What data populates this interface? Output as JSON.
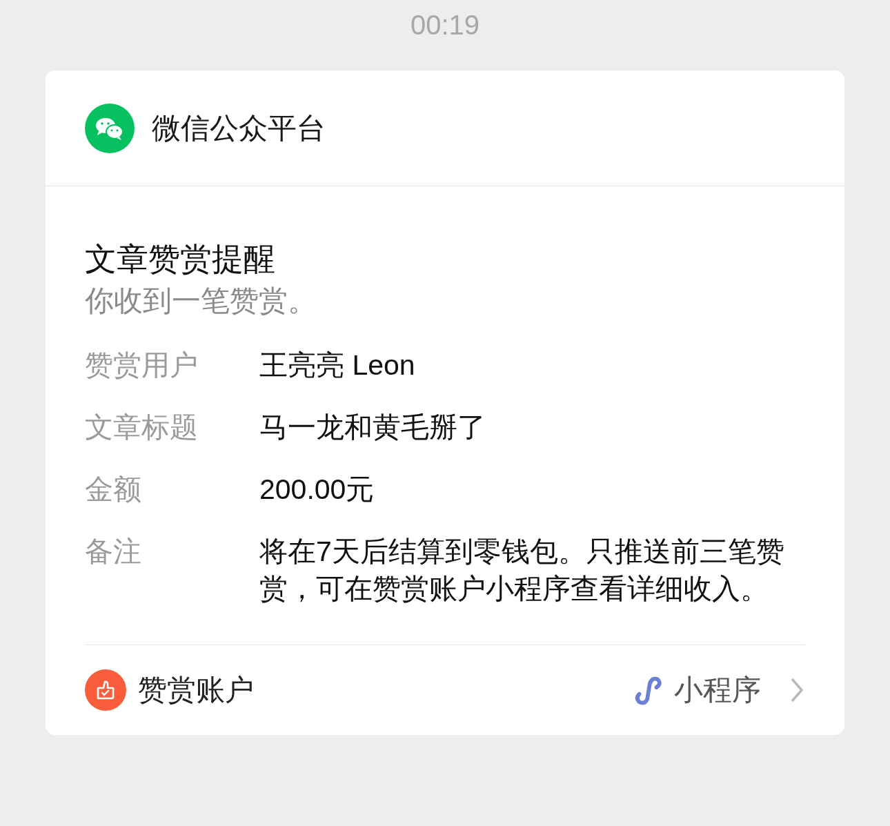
{
  "time": "00:19",
  "card": {
    "account": "微信公众平台",
    "title": "文章赞赏提醒",
    "subtitle": "你收到一笔赞赏。",
    "fields": [
      {
        "label": "赞赏用户",
        "value": "王亮亮 Leon"
      },
      {
        "label": "文章标题",
        "value": "马一龙和黄毛掰了"
      },
      {
        "label": "金额",
        "value": "200.00元"
      },
      {
        "label": "备注",
        "value": "将在7天后结算到零钱包。只推送前三笔赞赏，可在赞赏账户小程序查看详细收入。"
      }
    ],
    "footer": {
      "source": "赞赏账户",
      "tag": "小程序"
    }
  }
}
